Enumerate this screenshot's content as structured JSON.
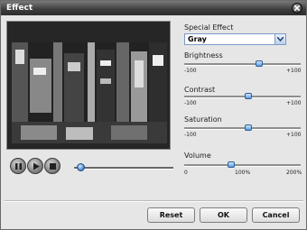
{
  "window": {
    "title": "Effect"
  },
  "effect": {
    "label": "Special Effect",
    "selected": "Gray"
  },
  "brightness": {
    "label": "Brightness",
    "min": "-100",
    "max": "+100",
    "value_fraction": 0.65
  },
  "contrast": {
    "label": "Contrast",
    "min": "-100",
    "max": "+100",
    "value_fraction": 0.55
  },
  "saturation": {
    "label": "Saturation",
    "min": "-100",
    "max": "+100",
    "value_fraction": 0.55
  },
  "volume": {
    "label": "Volume",
    "min": "0",
    "mid": "100%",
    "max": "200%",
    "value_fraction": 0.4
  },
  "playback": {
    "position_fraction": 0.03
  },
  "buttons": {
    "reset": "Reset",
    "ok": "OK",
    "cancel": "Cancel"
  },
  "icons": {
    "close": "close-icon",
    "pause": "pause-icon",
    "play": "play-icon",
    "stop": "stop-icon",
    "dropdown": "chevron-down-icon"
  }
}
